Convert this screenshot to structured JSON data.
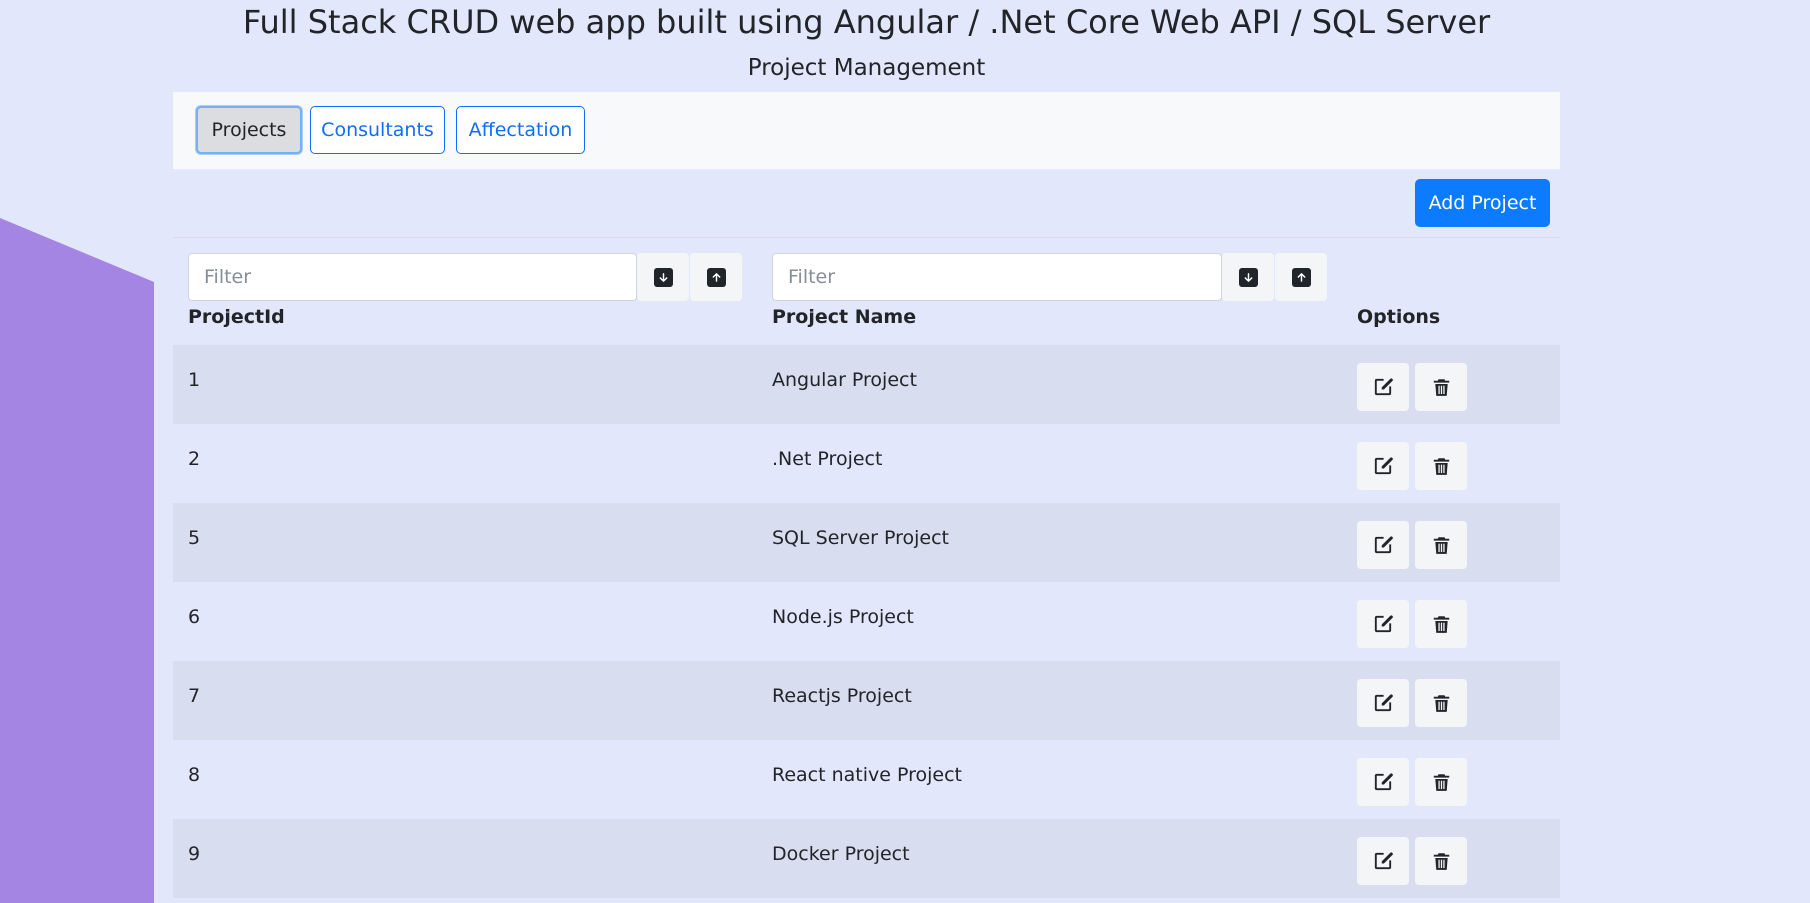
{
  "header": {
    "title": "Full Stack CRUD web app built using Angular / .Net Core Web API / SQL Server",
    "subtitle": "Project Management"
  },
  "nav": {
    "tabs": [
      {
        "label": "Projects",
        "active": true
      },
      {
        "label": "Consultants",
        "active": false
      },
      {
        "label": "Affectation",
        "active": false
      }
    ]
  },
  "toolbar": {
    "add_label": "Add Project"
  },
  "filters": {
    "id_placeholder": "Filter",
    "name_placeholder": "Filter"
  },
  "table": {
    "columns": [
      "ProjectId",
      "Project Name",
      "Options"
    ],
    "rows": [
      {
        "id": "1",
        "name": "Angular Project"
      },
      {
        "id": "2",
        "name": ".Net Project"
      },
      {
        "id": "5",
        "name": "SQL Server Project"
      },
      {
        "id": "6",
        "name": "Node.js Project"
      },
      {
        "id": "7",
        "name": "Reactjs Project"
      },
      {
        "id": "8",
        "name": "React native Project"
      },
      {
        "id": "9",
        "name": "Docker Project"
      }
    ]
  },
  "icons": {
    "sort_down": "arrow-down-icon",
    "sort_up": "arrow-up-icon",
    "edit": "pencil-square-icon",
    "delete": "trash-icon"
  },
  "colors": {
    "background": "#e3e7fb",
    "accent": "#0d6efd",
    "add_button": "#0d7bff",
    "side_shape": "#a485e3"
  }
}
